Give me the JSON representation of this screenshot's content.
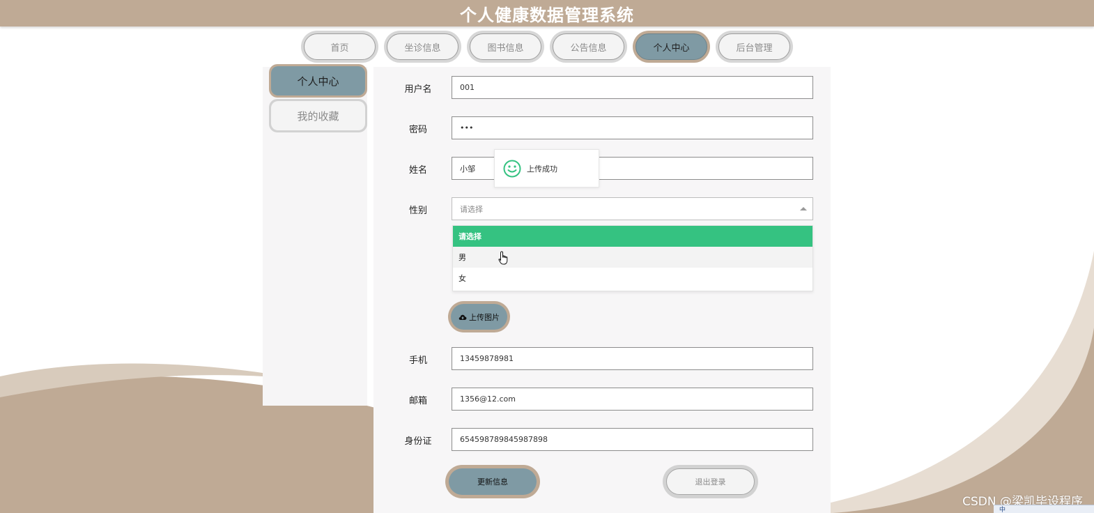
{
  "app": {
    "title": "个人健康数据管理系统"
  },
  "nav": {
    "items": [
      {
        "label": "首页"
      },
      {
        "label": "坐诊信息"
      },
      {
        "label": "图书信息"
      },
      {
        "label": "公告信息"
      },
      {
        "label": "个人中心",
        "active": true
      },
      {
        "label": "后台管理"
      }
    ]
  },
  "sidebar": {
    "items": [
      {
        "label": "个人中心",
        "active": true
      },
      {
        "label": "我的收藏"
      }
    ]
  },
  "form": {
    "username": {
      "label": "用户名",
      "value": "001"
    },
    "password": {
      "label": "密码",
      "value": "•••"
    },
    "name": {
      "label": "姓名",
      "value": "小邹"
    },
    "gender": {
      "label": "性别",
      "placeholder": "请选择",
      "options": [
        "请选择",
        "男",
        "女"
      ]
    },
    "upload_label": "上传图片",
    "phone": {
      "label": "手机",
      "value": "13459878981"
    },
    "email": {
      "label": "邮箱",
      "value": "1356@12.com"
    },
    "id_card": {
      "label": "身份证",
      "value": "654598789845987898"
    },
    "update_label": "更新信息",
    "logout_label": "退出登录"
  },
  "toast": {
    "message": "上传成功",
    "icon": "smile-icon"
  },
  "watermark": "CSDN @梁凯毕设程序",
  "tray": {
    "ime": "中"
  },
  "colors": {
    "header": "#bfaa95",
    "active": "#7f9aa4",
    "selected_option": "#35c281",
    "background_wave": "#bfaa95"
  }
}
